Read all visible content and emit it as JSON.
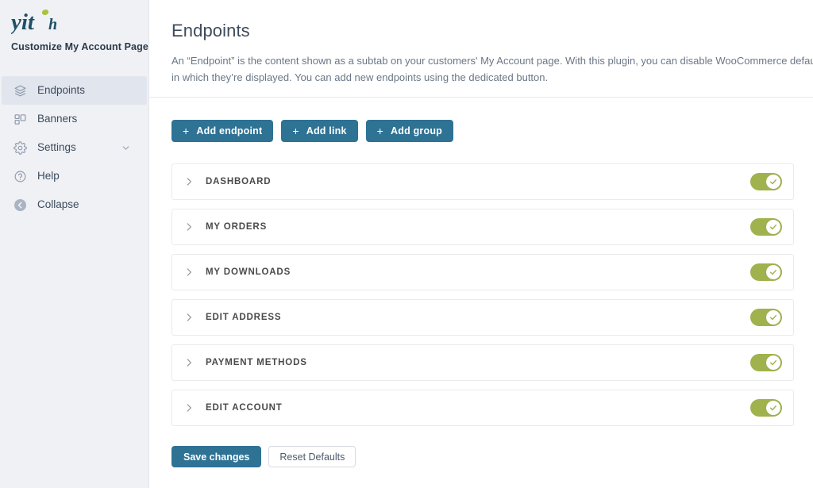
{
  "sidebar": {
    "logo_text": "yith",
    "logo_icon": "yith-logo",
    "subtitle": "Customize My Account Page",
    "items": [
      {
        "label": "Endpoints",
        "icon": "layers-icon",
        "active": true,
        "chevron": false
      },
      {
        "label": "Banners",
        "icon": "blocks-icon",
        "active": false,
        "chevron": false
      },
      {
        "label": "Settings",
        "icon": "gear-icon",
        "active": false,
        "chevron": true
      },
      {
        "label": "Help",
        "icon": "question-circle-icon",
        "active": false,
        "chevron": false
      },
      {
        "label": "Collapse",
        "icon": "collapse-arrow-icon",
        "active": false,
        "chevron": false
      }
    ]
  },
  "header": {
    "title": "Endpoints",
    "description_line1": "An “Endpoint” is the content shown as a subtab on your customers' My Account page. With this plugin, you can disable WooCommerce default endpoints (Dashb",
    "description_line2": "in which they’re displayed. You can add new endpoints using the dedicated button."
  },
  "toolbar": {
    "buttons": [
      {
        "label": "Add endpoint",
        "icon": "plus-icon"
      },
      {
        "label": "Add link",
        "icon": "plus-icon"
      },
      {
        "label": "Add group",
        "icon": "plus-icon"
      }
    ]
  },
  "endpoints": [
    {
      "label": "DASHBOARD",
      "enabled": true,
      "expand_icon": "chevron-right-icon",
      "toggle_icon": "check-icon"
    },
    {
      "label": "MY ORDERS",
      "enabled": true,
      "expand_icon": "chevron-right-icon",
      "toggle_icon": "check-icon"
    },
    {
      "label": "MY DOWNLOADS",
      "enabled": true,
      "expand_icon": "chevron-right-icon",
      "toggle_icon": "check-icon"
    },
    {
      "label": "EDIT ADDRESS",
      "enabled": true,
      "expand_icon": "chevron-right-icon",
      "toggle_icon": "check-icon"
    },
    {
      "label": "PAYMENT METHODS",
      "enabled": true,
      "expand_icon": "chevron-right-icon",
      "toggle_icon": "check-icon"
    },
    {
      "label": "EDIT ACCOUNT",
      "enabled": true,
      "expand_icon": "chevron-right-icon",
      "toggle_icon": "check-icon"
    }
  ],
  "footer": {
    "save_label": "Save changes",
    "reset_label": "Reset Defaults"
  },
  "colors": {
    "accent_blue": "#2e7294",
    "toggle_green": "#9fb24d",
    "sidebar_bg": "#eff1f5",
    "sidebar_active": "#e1e5ed",
    "logo_dark": "#1f5066",
    "logo_dot_green": "#a9c23f"
  }
}
